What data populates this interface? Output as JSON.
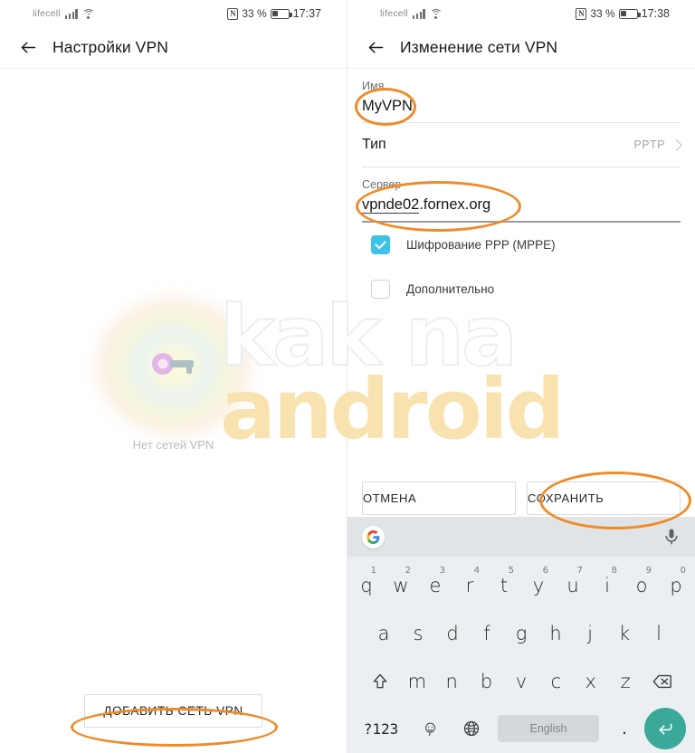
{
  "left": {
    "statusbar": {
      "carrier": "lifecell",
      "nfc": "N",
      "battery_pct": "33 %",
      "clock": "17:37"
    },
    "appbar": {
      "title": "Настройки VPN",
      "back_icon": "back-arrow-icon"
    },
    "empty_state": {
      "text": "Нет сетей VPN",
      "icon": "vpn-key-icon"
    },
    "add_button": {
      "label": "ДОБАВИТЬ СЕТЬ VPN"
    }
  },
  "right": {
    "statusbar": {
      "carrier": "lifecell",
      "nfc": "N",
      "battery_pct": "33 %",
      "clock": "17:38"
    },
    "appbar": {
      "title": "Изменение сети VPN",
      "back_icon": "back-arrow-icon"
    },
    "form": {
      "name": {
        "label": "Имя",
        "value": "MyVPN"
      },
      "type": {
        "label": "Тип",
        "value": "PPTP"
      },
      "server": {
        "label": "Сервер",
        "value": "vpnde02.fornex.org",
        "underlined_part": "vpnde02",
        "rest_part": ".fornex.org"
      },
      "encryption": {
        "label": "Шифрование PPP (MPPE)",
        "checked": true
      },
      "advanced": {
        "label": "Дополнительно",
        "checked": false
      }
    },
    "actions": {
      "cancel": "ОТМЕНА",
      "save": "СОХРАНИТЬ"
    }
  },
  "keyboard": {
    "row1": [
      {
        "key": "q",
        "num": "1"
      },
      {
        "key": "w",
        "num": "2"
      },
      {
        "key": "e",
        "num": "3"
      },
      {
        "key": "r",
        "num": "4"
      },
      {
        "key": "t",
        "num": "5"
      },
      {
        "key": "y",
        "num": "6"
      },
      {
        "key": "u",
        "num": "7"
      },
      {
        "key": "i",
        "num": "8"
      },
      {
        "key": "o",
        "num": "9"
      },
      {
        "key": "p",
        "num": "0"
      }
    ],
    "row2": [
      {
        "key": "a"
      },
      {
        "key": "s"
      },
      {
        "key": "d"
      },
      {
        "key": "f"
      },
      {
        "key": "g"
      },
      {
        "key": "h"
      },
      {
        "key": "j"
      },
      {
        "key": "k"
      },
      {
        "key": "l"
      }
    ],
    "row3": [
      {
        "key": "z"
      },
      {
        "key": "x"
      },
      {
        "key": "c"
      },
      {
        "key": "v"
      },
      {
        "key": "b"
      },
      {
        "key": "n"
      },
      {
        "key": "m"
      }
    ],
    "shift_icon": "shift-icon",
    "backspace_icon": "backspace-icon",
    "numbers_key": "?123",
    "emoji_key": "emoji-icon",
    "globe_key": "globe-icon",
    "space_label": "English",
    "period_key": ".",
    "enter_icon": "enter-icon",
    "google_icon": "google-icon",
    "mic_icon": "microphone-icon"
  },
  "watermark": {
    "line1": "kak na",
    "line2": "android"
  },
  "colors": {
    "accent_orange": "#ef8b29",
    "checkbox_on": "#3ec2e8",
    "enter_key": "#3aa99a"
  }
}
